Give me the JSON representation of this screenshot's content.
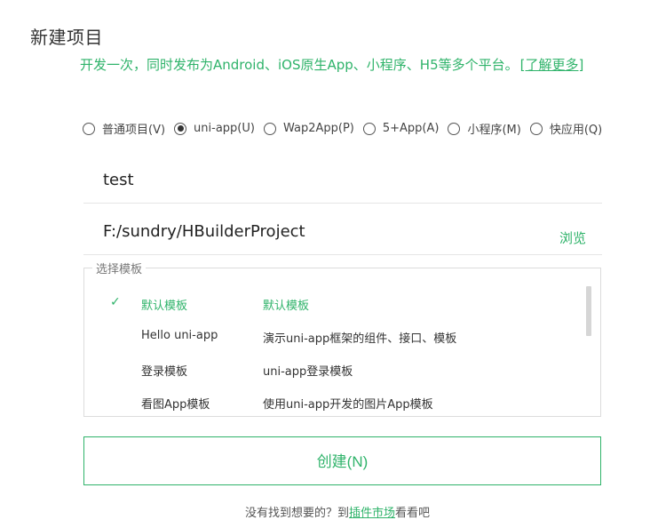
{
  "header": {
    "title": "新建项目",
    "subtitle": "开发一次，同时发布为Android、iOS原生App、小程序、H5等多个平台。",
    "learn_more": "[了解更多]"
  },
  "project_types": {
    "options": [
      {
        "label": "普通项目(V)",
        "checked": false
      },
      {
        "label": "uni-app(U)",
        "checked": true
      },
      {
        "label": "Wap2App(P)",
        "checked": false
      },
      {
        "label": "5+App(A)",
        "checked": false
      },
      {
        "label": "小程序(M)",
        "checked": false
      },
      {
        "label": "快应用(Q)",
        "checked": false
      }
    ]
  },
  "form": {
    "project_name": "test",
    "project_path": "F:/sundry/HBuilderProject",
    "browse_label": "浏览"
  },
  "templates": {
    "legend": "选择模板",
    "items": [
      {
        "name": "默认模板",
        "desc": "默认模板",
        "selected": true
      },
      {
        "name": "Hello uni-app",
        "desc": "演示uni-app框架的组件、接口、模板",
        "selected": false
      },
      {
        "name": "登录模板",
        "desc": "uni-app登录模板",
        "selected": false
      },
      {
        "name": "看图App模板",
        "desc": "使用uni-app开发的图片App模板",
        "selected": false
      }
    ],
    "check_mark": "✓"
  },
  "actions": {
    "create_label": "创建(N)"
  },
  "footer": {
    "prefix": "没有找到想要的？到",
    "market_link": "插件市场",
    "suffix": "看看吧"
  },
  "colors": {
    "accent": "#2fb36a",
    "text": "#333333",
    "border": "#dcdcdc"
  }
}
